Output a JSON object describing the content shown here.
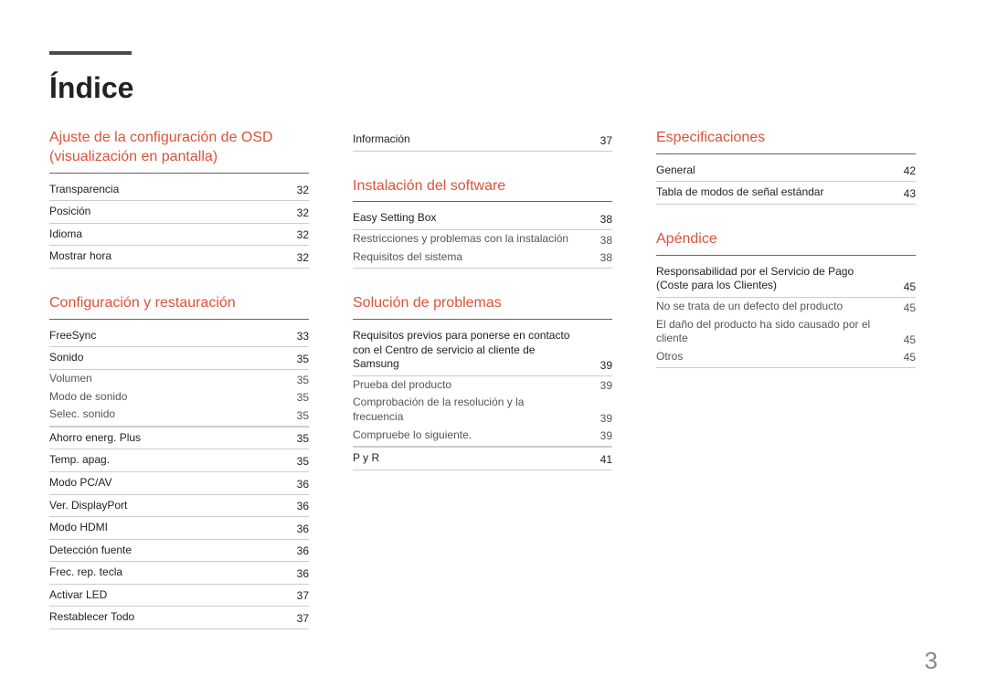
{
  "title": "Índice",
  "page_number": "3",
  "columns": [
    {
      "sections": [
        {
          "header": "Ajuste de la configuración de OSD (visualización en pantalla)",
          "entries": [
            {
              "label": "Transparencia",
              "page": "32"
            },
            {
              "label": "Posición",
              "page": "32"
            },
            {
              "label": "Idioma",
              "page": "32"
            },
            {
              "label": "Mostrar hora",
              "page": "32"
            }
          ]
        },
        {
          "header": "Configuración y restauración",
          "entries": [
            {
              "label": "FreeSync",
              "page": "33"
            },
            {
              "label": "Sonido",
              "page": "35"
            },
            {
              "label": "Volumen",
              "page": "35",
              "sub": true
            },
            {
              "label": "Modo de sonido",
              "page": "35",
              "sub": true
            },
            {
              "label": "Selec. sonido",
              "page": "35",
              "sub": true,
              "last_sub": true
            },
            {
              "label": "Ahorro energ. Plus",
              "page": "35"
            },
            {
              "label": "Temp. apag.",
              "page": "35"
            },
            {
              "label": "Modo PC/AV",
              "page": "36"
            },
            {
              "label": "Ver. DisplayPort",
              "page": "36"
            },
            {
              "label": "Modo HDMI",
              "page": "36"
            },
            {
              "label": "Detección fuente",
              "page": "36"
            },
            {
              "label": "Frec. rep. tecla",
              "page": "36"
            },
            {
              "label": "Activar LED",
              "page": "37"
            },
            {
              "label": "Restablecer Todo",
              "page": "37"
            }
          ]
        }
      ]
    },
    {
      "sections": [
        {
          "header": null,
          "entries": [
            {
              "label": "Información",
              "page": "37"
            }
          ]
        },
        {
          "header": "Instalación del software",
          "entries": [
            {
              "label": "Easy Setting Box",
              "page": "38"
            },
            {
              "label": "Restricciones y problemas con la instalación",
              "page": "38",
              "sub": true
            },
            {
              "label": "Requisitos del sistema",
              "page": "38",
              "sub": true,
              "last_sub": true
            }
          ]
        },
        {
          "header": "Solución de problemas",
          "entries": [
            {
              "label": "Requisitos previos para ponerse en contacto con el Centro de servicio al cliente de Samsung",
              "page": "39"
            },
            {
              "label": "Prueba del producto",
              "page": "39",
              "sub": true
            },
            {
              "label": "Comprobación de la resolución y la frecuencia",
              "page": "39",
              "sub": true
            },
            {
              "label": "Compruebe lo siguiente.",
              "page": "39",
              "sub": true,
              "last_sub": true
            },
            {
              "label": "P y R",
              "page": "41"
            }
          ]
        }
      ]
    },
    {
      "sections": [
        {
          "header": "Especificaciones",
          "entries": [
            {
              "label": "General",
              "page": "42"
            },
            {
              "label": "Tabla de modos de señal estándar",
              "page": "43"
            }
          ]
        },
        {
          "header": "Apéndice",
          "entries": [
            {
              "label": "Responsabilidad por el Servicio de Pago (Coste para los Clientes)",
              "page": "45"
            },
            {
              "label": "No se trata de un defecto del producto",
              "page": "45",
              "sub": true
            },
            {
              "label": "El daño del producto ha sido causado por el cliente",
              "page": "45",
              "sub": true
            },
            {
              "label": "Otros",
              "page": "45",
              "sub": true,
              "last_sub": true
            }
          ]
        }
      ]
    }
  ]
}
